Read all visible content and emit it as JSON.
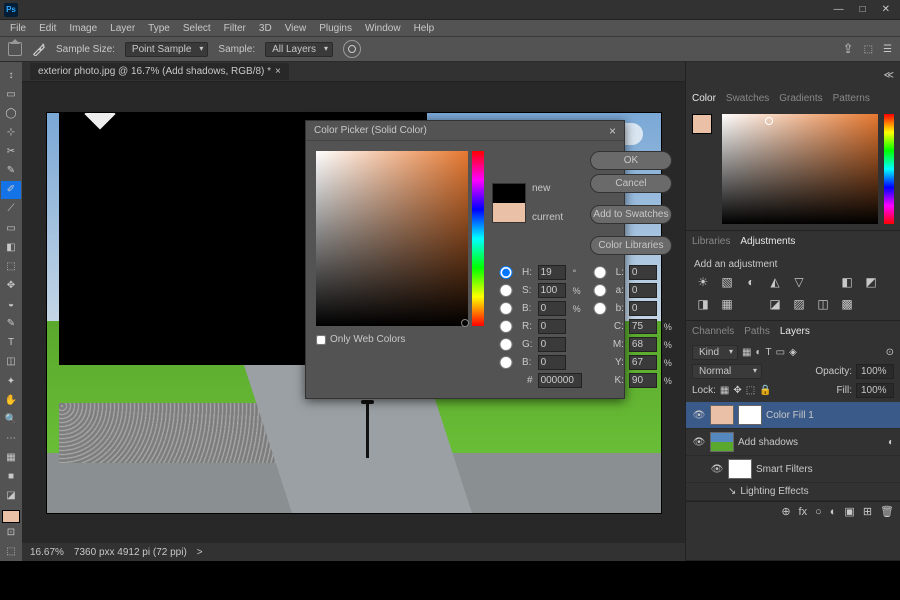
{
  "menubar": [
    "File",
    "Edit",
    "Image",
    "Layer",
    "Type",
    "Select",
    "Filter",
    "3D",
    "View",
    "Plugins",
    "Window",
    "Help"
  ],
  "optbar": {
    "sampleSizeLabel": "Sample Size:",
    "sampleSize": "Point Sample",
    "sampleLabel": "Sample:",
    "sample": "All Layers"
  },
  "tab": {
    "title": "exterior photo.jpg @ 16.7% (Add shadows, RGB/8) *",
    "close": "×"
  },
  "status": {
    "zoom": "16.67%",
    "dims": "7360 pxx 4912 pi (72 ppi)",
    "caret": ">"
  },
  "colorPanel": {
    "tabs": [
      "Color",
      "Swatches",
      "Gradients",
      "Patterns"
    ]
  },
  "adjPanel": {
    "tabs": [
      "Libraries",
      "Adjustments"
    ],
    "hint": "Add an adjustment",
    "icons": [
      "☀",
      "▧",
      "◐",
      "◭",
      "▽",
      "",
      "◧",
      "◩",
      "◨",
      "▦",
      "",
      "◪",
      "▨",
      "◫",
      "▩"
    ]
  },
  "layersPanel": {
    "tabs": [
      "Channels",
      "Paths",
      "Layers"
    ],
    "kind": "Kind",
    "blend": "Normal",
    "opacityLabel": "Opacity:",
    "opacity": "100%",
    "lockLabel": "Lock:",
    "fillLabel": "Fill:",
    "fill": "100%",
    "layers": [
      {
        "name": "Color Fill 1",
        "sel": true,
        "thumb": "peach",
        "mask": true
      },
      {
        "name": "Add shadows",
        "thumb": "photo",
        "hasSmart": true
      },
      {
        "name": "Smart Filters",
        "indent": true,
        "thumb": "mask"
      },
      {
        "name": "Lighting Effects",
        "indent": true,
        "fx": true
      }
    ],
    "footIcons": [
      "⊕",
      "fx",
      "○",
      "◐",
      "▣",
      "⊞",
      "🗑"
    ]
  },
  "dialog": {
    "title": "Color Picker (Solid Color)",
    "newLabel": "new",
    "currentLabel": "current",
    "newColor": "#000000",
    "currentColor": "#eac0a6",
    "buttons": {
      "ok": "OK",
      "cancel": "Cancel",
      "addSwatches": "Add to Swatches",
      "libraries": "Color Libraries"
    },
    "fields": {
      "H": "19",
      "Hsuf": "°",
      "S": "100",
      "Ssuf": "%",
      "B": "0",
      "Bsuf": "%",
      "L": "0",
      "a": "0",
      "b": "0",
      "R": "0",
      "G": "0",
      "Bv": "0",
      "C": "75",
      "M": "68",
      "Y": "67",
      "K": "90",
      "hex": "000000"
    },
    "webOnly": "Only Web Colors"
  },
  "chart_data": null
}
